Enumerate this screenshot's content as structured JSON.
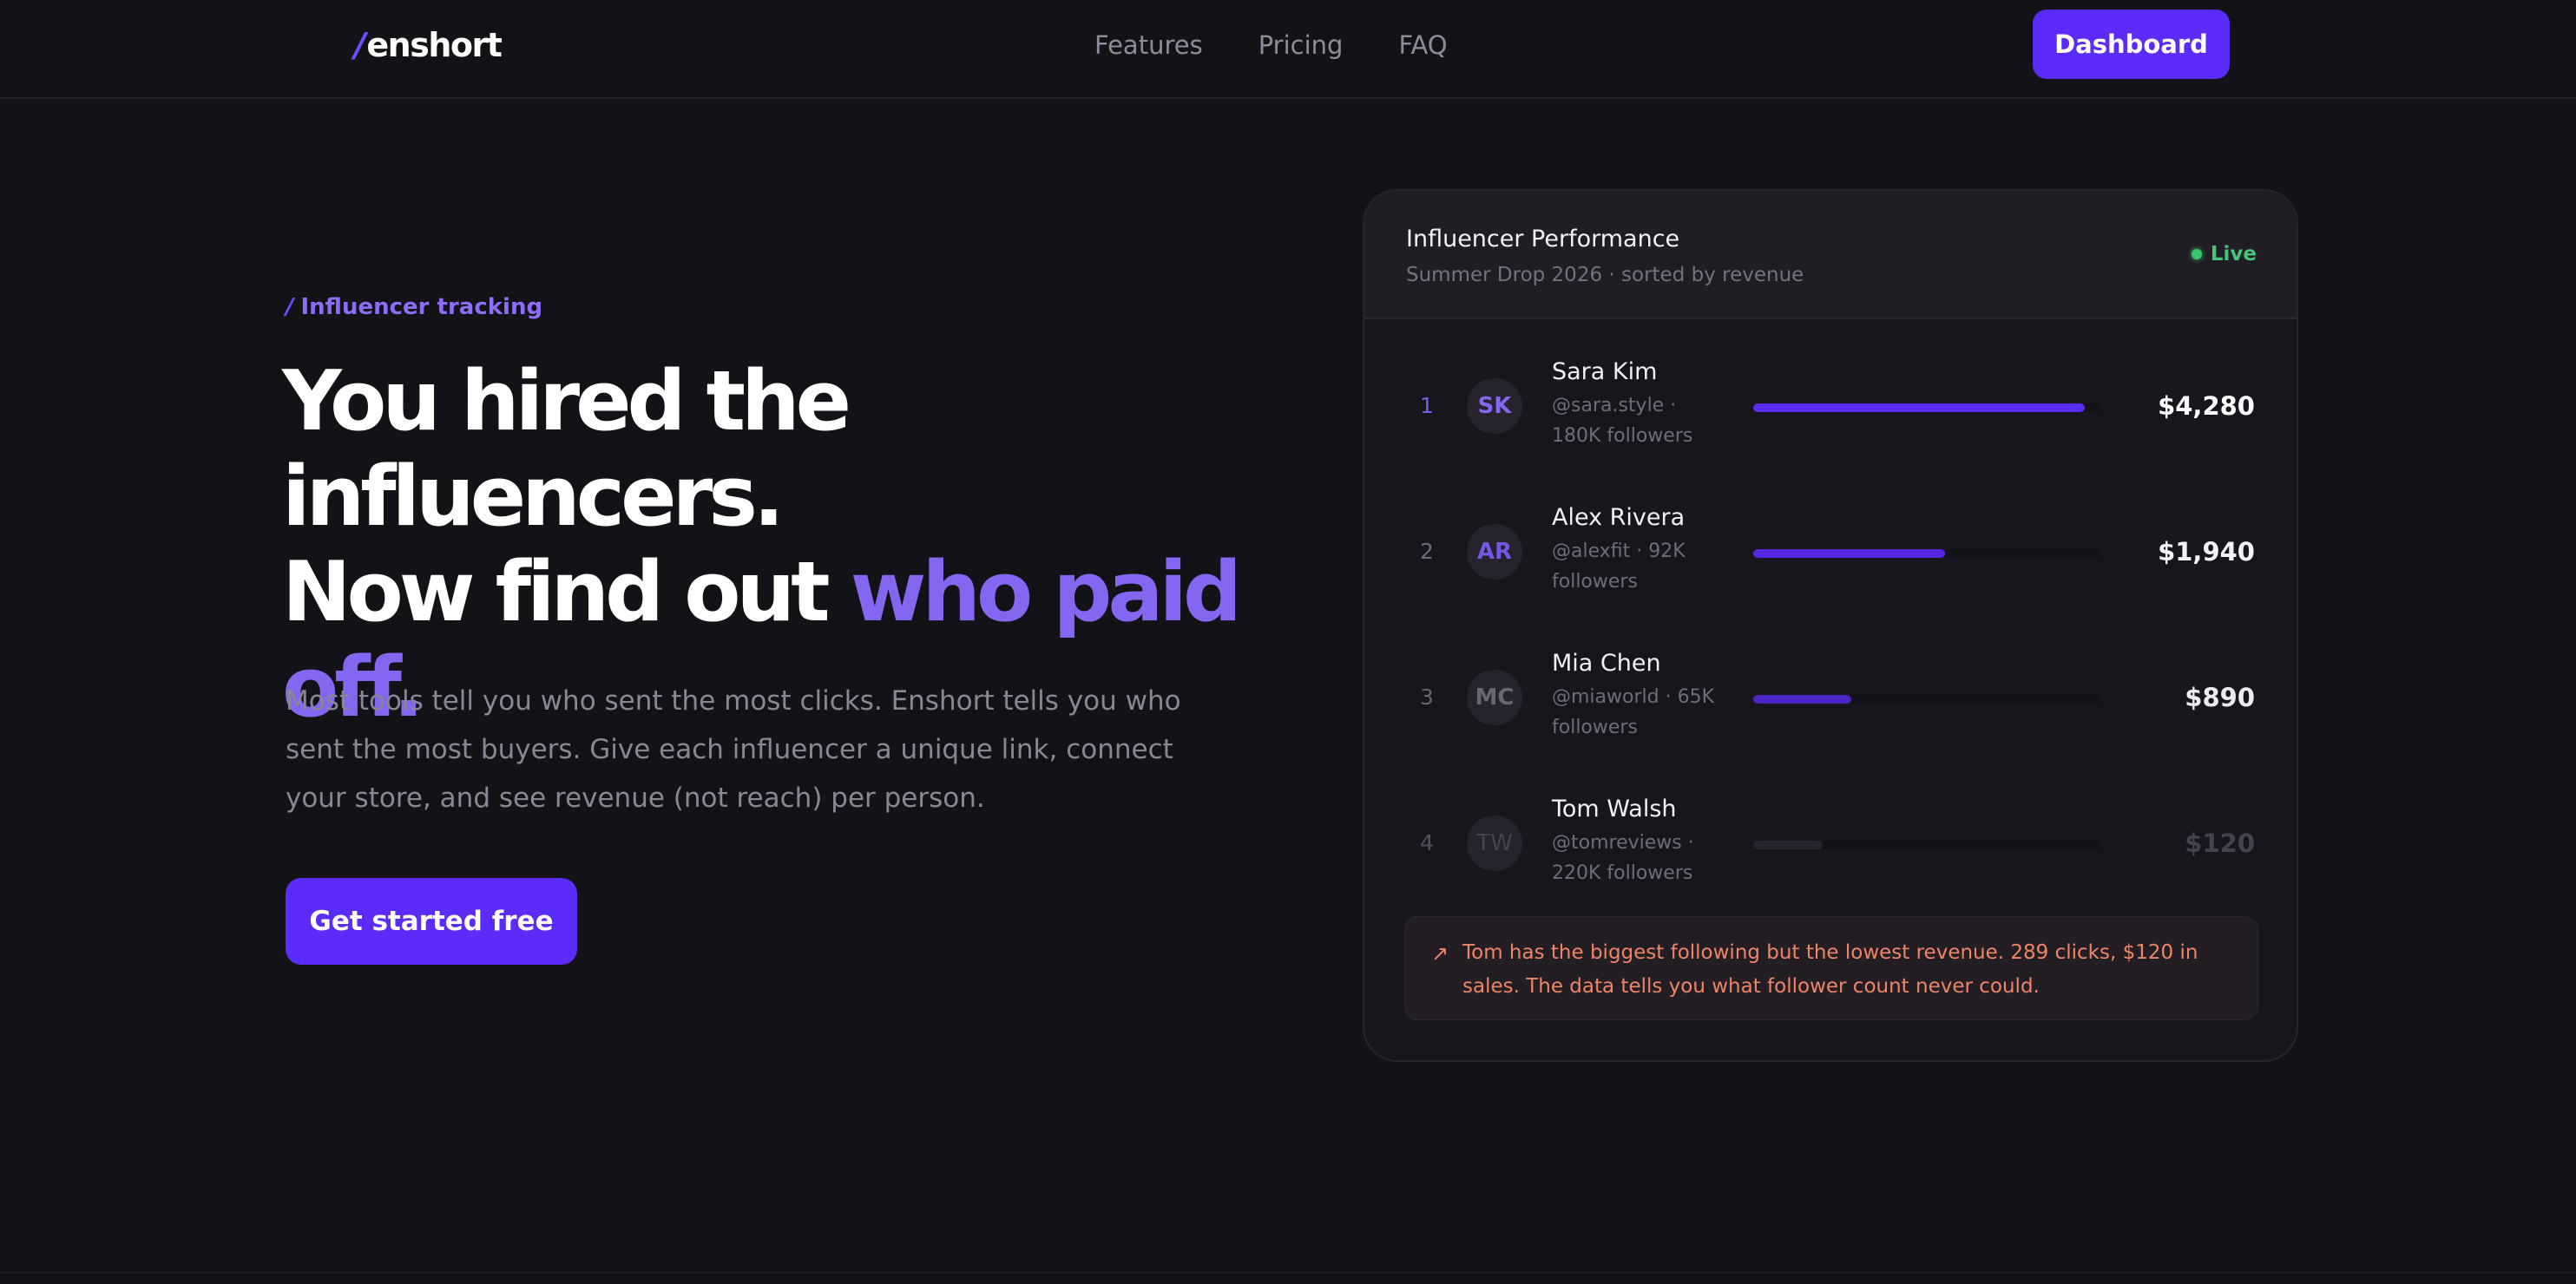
{
  "nav": {
    "logo_slash": "/",
    "logo_text": "enshort",
    "links": [
      "Features",
      "Pricing",
      "FAQ"
    ],
    "cta_label": "Dashboard"
  },
  "hero": {
    "eyebrow_slash": "/",
    "eyebrow": "Influencer tracking",
    "headline_line1": "You hired the influencers.",
    "headline_line2_plain": "Now find out ",
    "headline_accent": "who paid off.",
    "subtext": "Most tools tell you who sent the most clicks. Enshort tells you who sent the most buyers. Give each influencer a unique link, connect your store, and see revenue (not reach) per person.",
    "cta_label": "Get started free"
  },
  "card": {
    "title": "Influencer Performance",
    "subtitle": "Summer Drop 2026 · sorted by revenue",
    "live_label": "Live",
    "rows": [
      {
        "rank": "1",
        "initials": "SK",
        "name": "Sara Kim",
        "handle": "@sara.style · 180K followers",
        "revenue": "$4,280",
        "share": 0.95
      },
      {
        "rank": "2",
        "initials": "AR",
        "name": "Alex Rivera",
        "handle": "@alexfit · 92K followers",
        "revenue": "$1,940",
        "share": 0.55
      },
      {
        "rank": "3",
        "initials": "MC",
        "name": "Mia Chen",
        "handle": "@miaworld · 65K followers",
        "revenue": "$890",
        "share": 0.28
      },
      {
        "rank": "4",
        "initials": "TW",
        "name": "Tom Walsh",
        "handle": "@tomreviews · 220K followers",
        "revenue": "$120",
        "share": 0.2
      }
    ],
    "note_icon": "arrow-up-right-icon",
    "note": "Tom has the biggest following but the lowest revenue. 289 clicks, $120 in sales. The data tells you what follower count never could."
  },
  "colors": {
    "accent": "#5b2bf7",
    "accent_text": "#8566f0",
    "live": "#3ac46e",
    "note": "#ef8467",
    "background": "#131217"
  }
}
